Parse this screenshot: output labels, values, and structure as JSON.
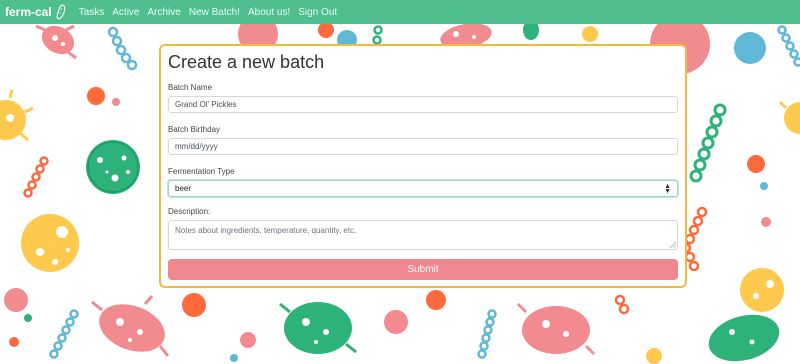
{
  "navbar": {
    "brand": "ferm-cal",
    "brand_icon": "pickle-icon",
    "links": [
      "Tasks",
      "Active",
      "Archive",
      "New Batch!",
      "About us!",
      "Sign Out"
    ]
  },
  "form": {
    "title": "Create a new batch",
    "batch_name": {
      "label": "Batch Name",
      "value": "Grand Ol' Pickles"
    },
    "batch_birthday": {
      "label": "Batch Birthday",
      "placeholder": "mm/dd/yyyy"
    },
    "fermentation_type": {
      "label": "Fermentation Type",
      "selected": "beer"
    },
    "description": {
      "label": "Description:",
      "placeholder": "Notes about ingredients, temperature, quantity, etc."
    },
    "submit_label": "Submit"
  },
  "colors": {
    "navbar": "#4fc08d",
    "card_border": "#f5b942",
    "submit": "#f0868e",
    "microbe_pink": "#f28b8f",
    "microbe_green": "#2db37a",
    "microbe_orange": "#ff6a3d",
    "microbe_yellow": "#ffc94d",
    "microbe_blue": "#5fb8d6"
  }
}
